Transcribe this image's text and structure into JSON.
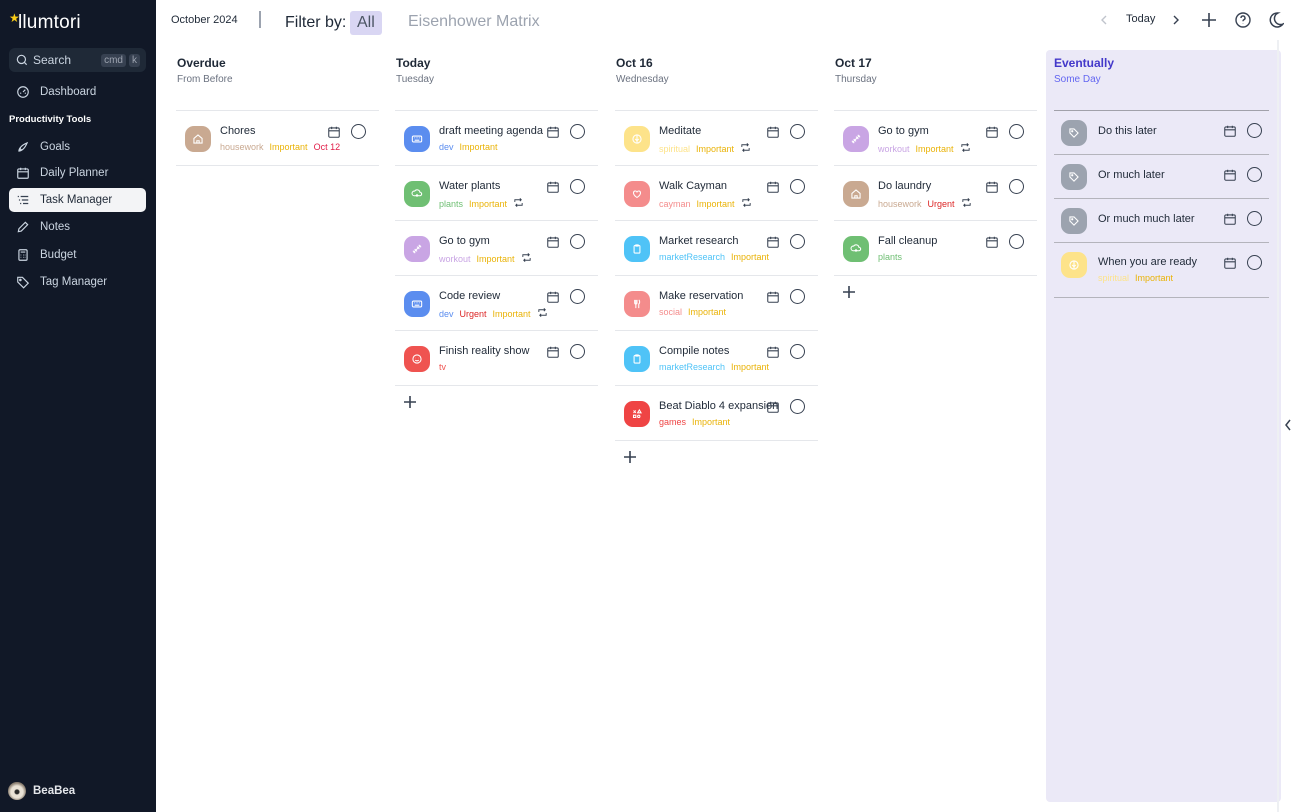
{
  "app": {
    "name": "llumtori"
  },
  "sidebar": {
    "search": {
      "placeholder": "Search",
      "kbd1": "cmd",
      "kbd2": "k"
    },
    "dashboard": "Dashboard",
    "section": "Productivity Tools",
    "items": [
      {
        "label": "Goals",
        "icon": "rocket-icon"
      },
      {
        "label": "Daily Planner",
        "icon": "calendar-icon"
      },
      {
        "label": "Task Manager",
        "icon": "list-icon",
        "active": true
      },
      {
        "label": "Notes",
        "icon": "pencil-icon"
      },
      {
        "label": "Budget",
        "icon": "calculator-icon"
      },
      {
        "label": "Tag Manager",
        "icon": "tag-icon"
      }
    ],
    "user": "BeaBea"
  },
  "topbar": {
    "month": "October 2024",
    "filter_label": "Filter by:",
    "filter_all": "All",
    "filter_eisenhower": "Eisenhower Matrix",
    "today": "Today"
  },
  "colors": {
    "housework": "#c9a991",
    "dev": "#5b8def",
    "plants": "#6fbf73",
    "workout": "#c9a5e4",
    "tv": "#ef5350",
    "spiritual": "#fde38a",
    "cayman": "#f48c8c",
    "marketResearch": "#4fc3f7",
    "social": "#f48c8c",
    "games": "#ef4444",
    "Important": "#eab308",
    "Urgent": "#dc2626",
    "grey": "#9ca3af",
    "accent": "#4338ca"
  },
  "columns": [
    {
      "title": "Overdue",
      "sub": "From Before",
      "tasks": [
        {
          "name": "Chores",
          "icon": "home-icon",
          "tag": "housework",
          "labels": [
            "Important"
          ],
          "date": "Oct 12"
        }
      ]
    },
    {
      "title": "Today",
      "sub": "Tuesday",
      "tasks": [
        {
          "name": "draft meeting agenda",
          "icon": "keyboard-icon",
          "tag": "dev",
          "labels": [
            "Important"
          ]
        },
        {
          "name": "Water plants",
          "icon": "plant-icon",
          "tag": "plants",
          "labels": [
            "Important"
          ],
          "repeat": true
        },
        {
          "name": "Go to gym",
          "icon": "dumbbell-icon",
          "tag": "workout",
          "labels": [
            "Important"
          ],
          "repeat": true
        },
        {
          "name": "Code review",
          "icon": "keyboard-icon",
          "tag": "dev",
          "labels": [
            "Urgent",
            "Important"
          ],
          "repeat": true
        },
        {
          "name": "Finish reality show",
          "icon": "smiley-icon",
          "tag": "tv",
          "labels": []
        }
      ]
    },
    {
      "title": "Oct 16",
      "sub": "Wednesday",
      "tasks": [
        {
          "name": "Meditate",
          "icon": "yin-yang-icon",
          "tag": "spiritual",
          "labels": [
            "Important"
          ],
          "repeat": true
        },
        {
          "name": "Walk Cayman",
          "icon": "heart-icon",
          "tag": "cayman",
          "labels": [
            "Important"
          ],
          "repeat": true
        },
        {
          "name": "Market research",
          "icon": "clipboard-icon",
          "tag": "marketResearch",
          "labels": [
            "Important"
          ]
        },
        {
          "name": "Make reservation",
          "icon": "utensils-icon",
          "tag": "social",
          "labels": [
            "Important"
          ]
        },
        {
          "name": "Compile notes",
          "icon": "clipboard-icon",
          "tag": "marketResearch",
          "labels": [
            "Important"
          ]
        },
        {
          "name": "Beat Diablo 4 expansion",
          "icon": "gamepad-icon",
          "tag": "games",
          "labels": [
            "Important"
          ]
        }
      ]
    },
    {
      "title": "Oct 17",
      "sub": "Thursday",
      "tasks": [
        {
          "name": "Go to gym",
          "icon": "dumbbell-icon",
          "tag": "workout",
          "labels": [
            "Important"
          ],
          "repeat": true
        },
        {
          "name": "Do laundry",
          "icon": "home-icon",
          "tag": "housework",
          "labels": [
            "Urgent"
          ],
          "repeat": true
        },
        {
          "name": "Fall cleanup",
          "icon": "plant-icon",
          "tag": "plants",
          "labels": []
        }
      ]
    }
  ],
  "eventually": {
    "title": "Eventually",
    "sub": "Some Day",
    "tasks": [
      {
        "name": "Do this later",
        "icon": "tag-icon",
        "tag": null,
        "labels": []
      },
      {
        "name": "Or much later",
        "icon": "tag-icon",
        "tag": null,
        "labels": []
      },
      {
        "name": "Or much much later",
        "icon": "tag-icon",
        "tag": null,
        "labels": []
      },
      {
        "name": "When you are ready",
        "icon": "yin-yang-icon",
        "tag": "spiritual",
        "labels": [
          "Important"
        ]
      }
    ]
  }
}
